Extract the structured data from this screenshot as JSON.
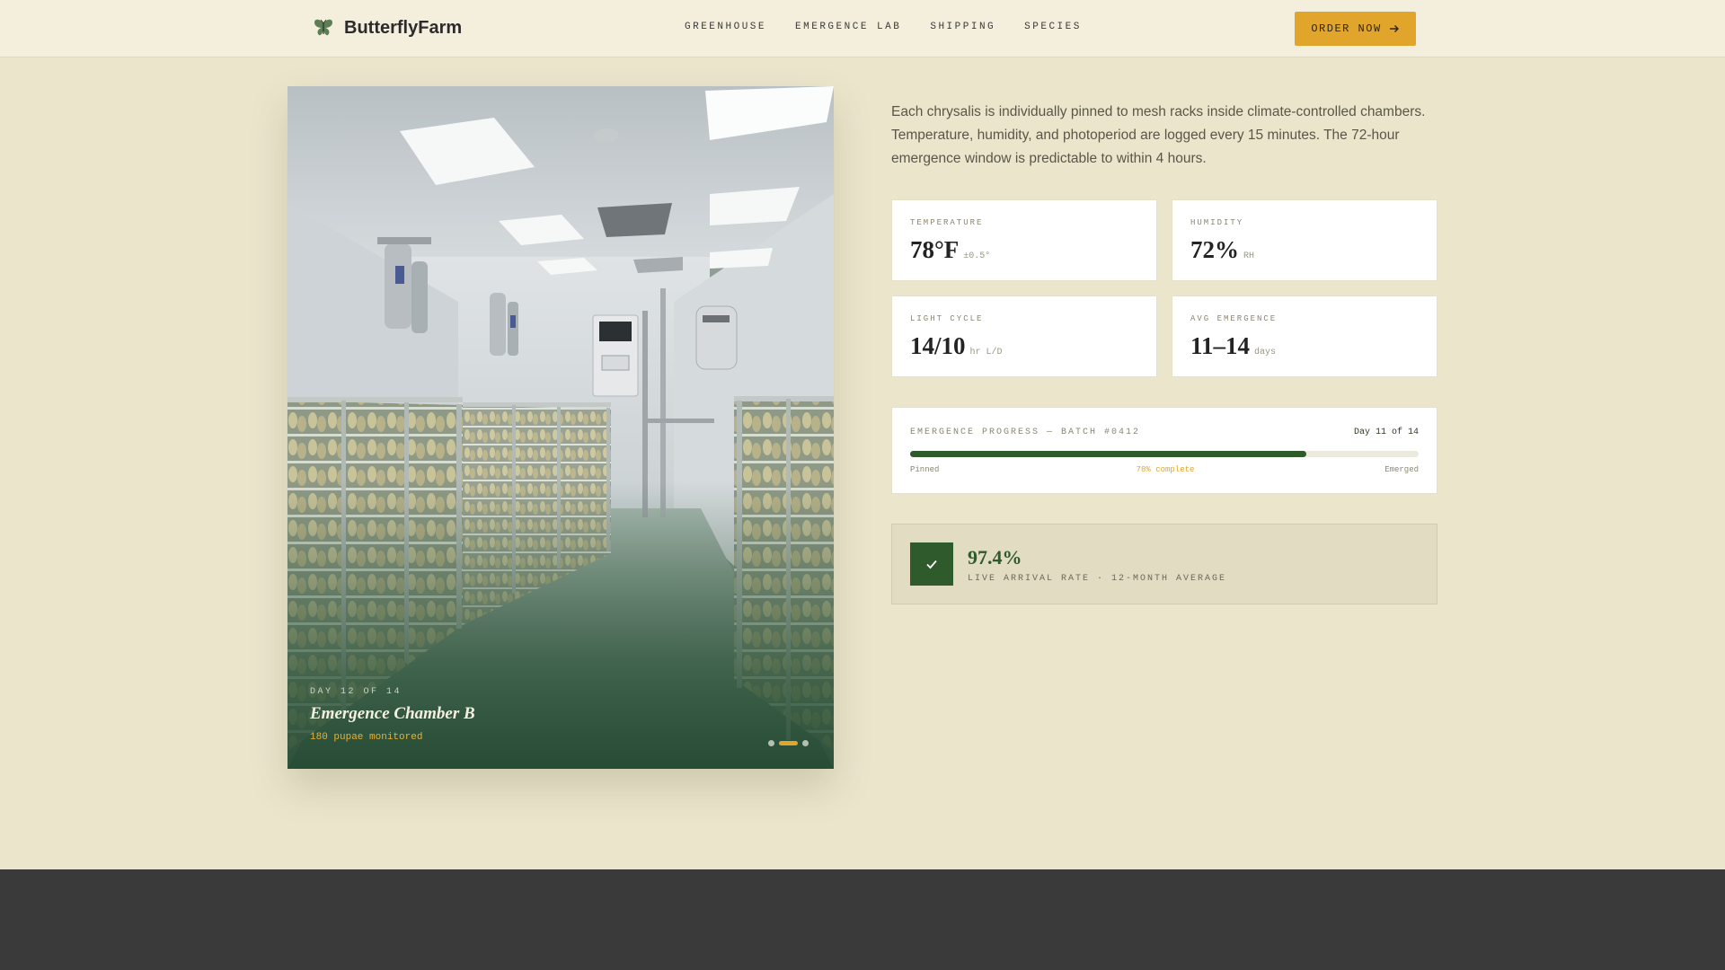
{
  "header": {
    "brand": "ButterflyFarm",
    "nav": [
      "GREENHOUSE",
      "EMERGENCE LAB",
      "SHIPPING",
      "SPECIES"
    ],
    "cta": "ORDER NOW"
  },
  "photo": {
    "caption_day": "DAY 12 OF 14",
    "caption_title": "Emergence Chamber B",
    "caption_sub": "180 pupae monitored",
    "slides_total": 3,
    "active_slide": 2
  },
  "main": {
    "description": "Each chrysalis is individually pinned to mesh racks inside climate-controlled chambers. Temperature, humidity, and photoperiod are logged every 15 minutes. The 72-hour emergence window is predictable to within 4 hours.",
    "stats": [
      {
        "label": "TEMPERATURE",
        "value": "78°F",
        "unit": "±0.5°"
      },
      {
        "label": "HUMIDITY",
        "value": "72%",
        "unit": "RH"
      },
      {
        "label": "LIGHT CYCLE",
        "value": "14/10",
        "unit": "hr L/D"
      },
      {
        "label": "AVG EMERGENCE",
        "value": "11–14",
        "unit": "days"
      }
    ],
    "progress": {
      "label": "EMERGENCE PROGRESS — BATCH #0412",
      "day": "Day 11 of 14",
      "percent": 78,
      "start": "Pinned",
      "mid": "78% complete",
      "end": "Emerged"
    },
    "arrival": {
      "value": "97.4%",
      "label": "LIVE ARRIVAL RATE · 12-MONTH AVERAGE"
    }
  },
  "colors": {
    "accent": "#e2a52c",
    "primary_green": "#2f5a2c",
    "background": "#ebe5cc",
    "footer": "#3a3a3a"
  }
}
